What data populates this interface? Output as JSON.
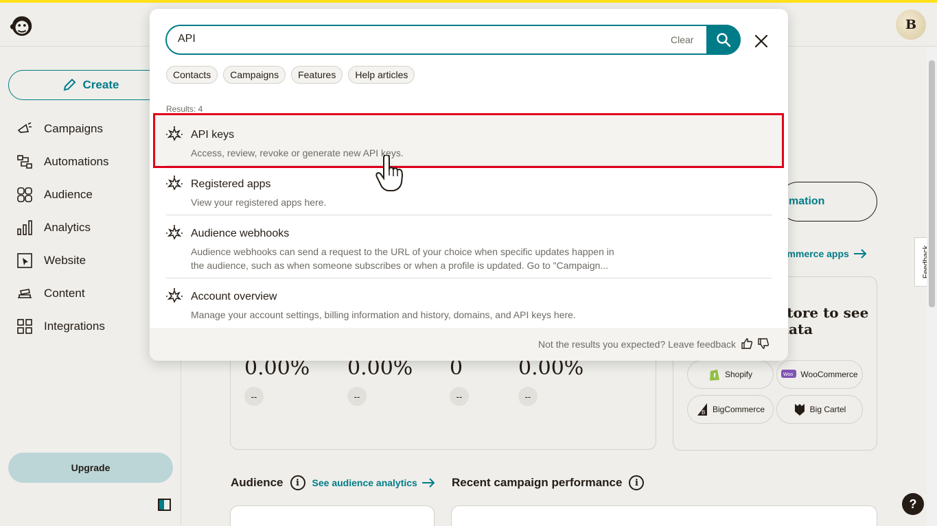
{
  "header": {
    "avatar_initial": "B",
    "accent_color": "#ffe01b"
  },
  "sidebar": {
    "create_label": "Create",
    "items": [
      {
        "label": "Campaigns",
        "icon": "megaphone-icon"
      },
      {
        "label": "Automations",
        "icon": "automation-flow-icon"
      },
      {
        "label": "Audience",
        "icon": "audience-icon"
      },
      {
        "label": "Analytics",
        "icon": "bar-chart-icon"
      },
      {
        "label": "Website",
        "icon": "website-cursor-icon"
      },
      {
        "label": "Content",
        "icon": "content-stack-icon"
      },
      {
        "label": "Integrations",
        "icon": "grid-icon"
      }
    ],
    "upgrade_label": "Upgrade"
  },
  "main": {
    "automation_button_partial": "mation",
    "commerce_link_partial": "ommerce apps",
    "stats": [
      {
        "value": "0.00%",
        "change": "--"
      },
      {
        "value": "0.00%",
        "change": "--"
      },
      {
        "value": "0",
        "change": "--"
      },
      {
        "value": "0.00%",
        "change": "--"
      }
    ],
    "store_card": {
      "title_partial": "store to see data",
      "stores": [
        "Shopify",
        "WooCommerce",
        "BigCommerce",
        "Big Cartel"
      ]
    },
    "audience_heading": "Audience",
    "audience_link": "See audience analytics",
    "recent_heading": "Recent campaign performance",
    "feedback_tab": "Feedback",
    "help_label": "?"
  },
  "search_modal": {
    "query": "API",
    "clear_label": "Clear",
    "filters": [
      "Contacts",
      "Campaigns",
      "Features",
      "Help articles"
    ],
    "results_count": "Results: 4",
    "results": [
      {
        "title": "API keys",
        "description": "Access, review, revoke or generate new API keys."
      },
      {
        "title": "Registered apps",
        "description": "View your registered apps here."
      },
      {
        "title": "Audience webhooks",
        "description": "Audience webhooks can send a request to the URL of your choice when specific updates happen in the audience, such as when someone subscribes or when a profile is updated. Go to \"Campaign..."
      },
      {
        "title": "Account overview",
        "description": "Manage your account settings, billing information and history, domains, and API keys here."
      }
    ],
    "footer_text": "Not the results you expected? Leave feedback",
    "brand_teal": "#007c89",
    "highlight_color": "#e0001b"
  }
}
